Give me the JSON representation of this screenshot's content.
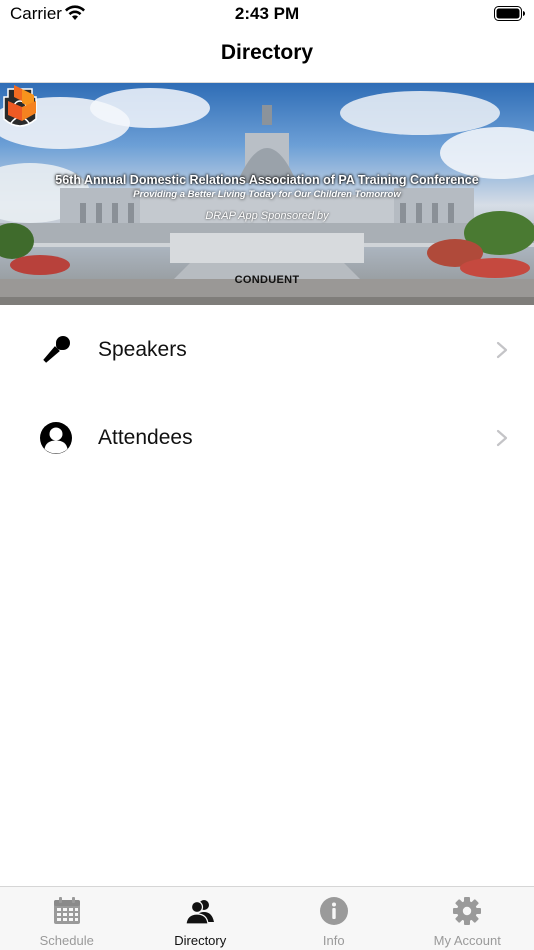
{
  "status_bar": {
    "carrier": "Carrier",
    "time": "2:43 PM",
    "wifi_icon": "wifi-icon",
    "battery_icon": "battery-icon"
  },
  "nav": {
    "title": "Directory"
  },
  "banner": {
    "title": "56th Annual Domestic Relations Association of PA Training Conference",
    "subtitle": "Providing a Better Living Today for Our Children Tomorrow",
    "sponsor": "DRAP App Sponsored by",
    "brand": "CONDUENT",
    "brand_color": "#f26b21"
  },
  "list": {
    "items": [
      {
        "label": "Speakers",
        "icon": "microphone-icon"
      },
      {
        "label": "Attendees",
        "icon": "person-icon"
      }
    ]
  },
  "tabs": [
    {
      "label": "Schedule",
      "icon": "calendar-icon",
      "active": false
    },
    {
      "label": "Directory",
      "icon": "people-icon",
      "active": true
    },
    {
      "label": "Info",
      "icon": "info-icon",
      "active": false
    },
    {
      "label": "My Account",
      "icon": "gear-icon",
      "active": false
    }
  ],
  "colors": {
    "tab_active": "#111111",
    "tab_inactive": "#9a9a9a",
    "chevron": "#c4c4c7"
  }
}
